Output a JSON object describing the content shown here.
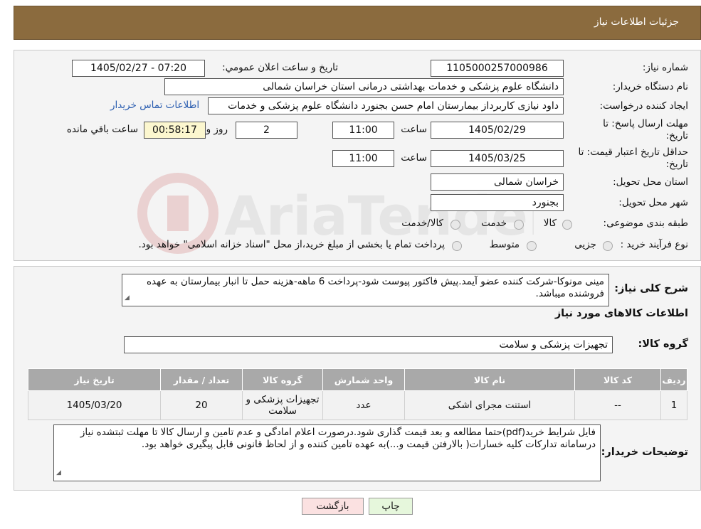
{
  "header": {
    "title": "جزئيات اطلاعات نیاز"
  },
  "fields": {
    "need_number_label": "شماره نیاز:",
    "need_number": "1105000257000986",
    "announce_label": "تاريخ و ساعت اعلان عمومي:",
    "announce_value": "1405/02/27 - 07:20",
    "buyer_label": "نام دستگاه خريدار:",
    "buyer_value": "دانشگاه علوم پزشکی و خدمات بهداشتی درمانی استان خراسان شمالی",
    "creator_label": "ایجاد کننده درخواست:",
    "creator_value": "داود نیازی کاربرداز بیمارستان امام حسن بجنورد دانشگاه علوم پزشکی و خدمات",
    "contact_link": "اطلاعات تماس خریدار",
    "deadline_label": "مهلت ارسال پاسخ: تا تاریخ:",
    "deadline_date": "1405/02/29",
    "time_label": "ساعت",
    "deadline_time": "11:00",
    "days_value": "2",
    "days_label": "روز و",
    "remaining_value": "00:58:17",
    "remaining_label": "ساعت باقي مانده",
    "validity_label": "حداقل تاریخ اعتبار قیمت: تا تاریخ:",
    "validity_date": "1405/03/25",
    "validity_time": "11:00",
    "province_label": "استان محل تحویل:",
    "province_value": "خراسان شمالی",
    "city_label": "شهر محل تحویل:",
    "city_value": "بجنورد",
    "category_label": "طبقه بندی موضوعی:",
    "category_options": [
      "کالا",
      "خدمت",
      "کالا/خدمت"
    ],
    "process_label": "نوع فرآیند خرید :",
    "process_options": [
      "جزیی",
      "متوسط"
    ],
    "process_note": "پرداخت تمام یا بخشی از مبلغ خرید،از محل \"اسناد خزانه اسلامی\" خواهد بود."
  },
  "description": {
    "label": "شرح کلی نیاز:",
    "text": "مینی مونوکا-شرکت کننده عضو آیمد.پیش فاکتور پیوست  شود-پرداخت 6 ماهه-هزینه حمل تا انبار بیمارستان به عهده فروشنده میباشد."
  },
  "goods": {
    "section_title": "اطلاعات کالاهای مورد نیاز",
    "group_label": "گروه کالا:",
    "group_value": "تجهیزات پزشکی و سلامت",
    "columns": [
      "ردیف",
      "کد کالا",
      "نام کالا",
      "واحد شمارش",
      "گروه کالا",
      "تعداد / مقدار",
      "تاریخ نیاز"
    ],
    "rows": [
      [
        "1",
        "--",
        "استنت مجرای اشکی",
        "عدد",
        "تجهیزات پزشکی و سلامت",
        "20",
        "1405/03/20"
      ]
    ]
  },
  "buyer_notes": {
    "label": "توضیحات خریدار:",
    "text": "فایل شرایط خرید(pdf)حتما مطالعه و بعد قیمت گذاری شود.درصورت اعلام امادگی و عدم تامین و ارسال کالا تا مهلت ثبتشده نیاز درسامانه تدارکات کلیه خسارات( بالارفتن قیمت و...)به عهده تامین کننده و از لحاظ قانونی قابل پیگیری خواهد بود."
  },
  "buttons": {
    "print": "چاپ",
    "back": "بازگشت"
  },
  "watermark": {
    "text": "AriaTender.net"
  },
  "colors": {
    "header": "#8b6b3e",
    "link": "#2a5db0",
    "back_button": "#fbe1e1",
    "print_button": "#e6f7dc"
  }
}
